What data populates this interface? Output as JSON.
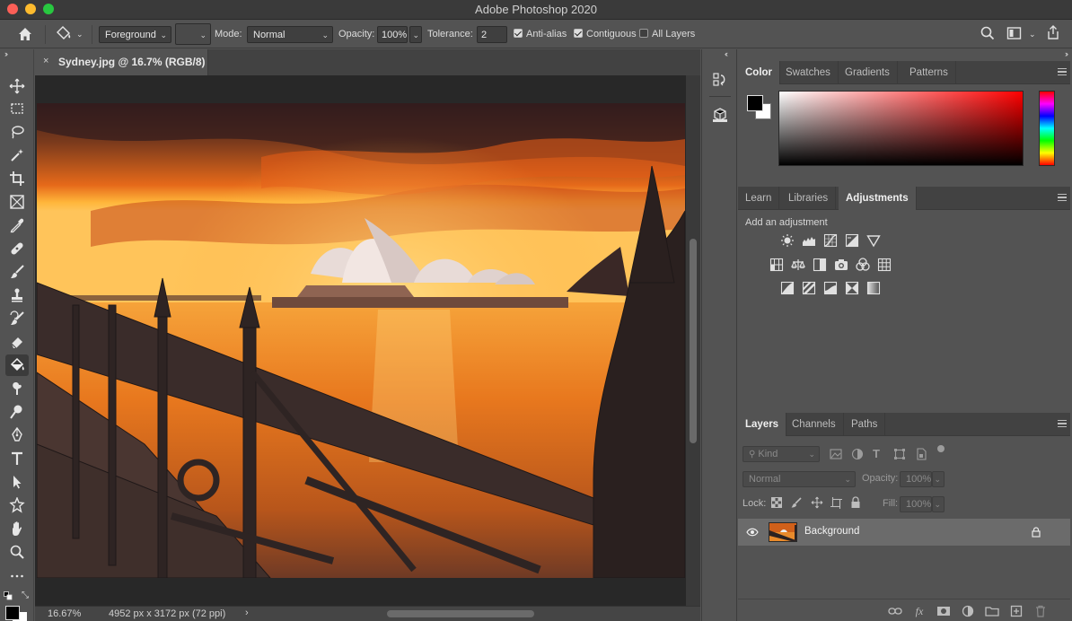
{
  "window": {
    "title": "Adobe Photoshop 2020"
  },
  "options": {
    "fill_source": "Foreground",
    "mode_label": "Mode:",
    "mode_value": "Normal",
    "opacity_label": "Opacity:",
    "opacity_value": "100%",
    "tolerance_label": "Tolerance:",
    "tolerance_value": "2",
    "anti_alias": "Anti-alias",
    "contiguous": "Contiguous",
    "all_layers": "All Layers"
  },
  "document": {
    "tab_title": "Sydney.jpg @ 16.7% (RGB/8)",
    "close": "×"
  },
  "status": {
    "zoom": "16.67%",
    "dimensions": "4952 px x 3172 px (72 ppi)",
    "arrow": "›"
  },
  "color_panel": {
    "tabs": [
      "Color",
      "Swatches",
      "Gradients",
      "Patterns"
    ]
  },
  "adjustments_panel": {
    "tabs": [
      "Learn",
      "Libraries",
      "Adjustments"
    ],
    "add_label": "Add an adjustment"
  },
  "layers_panel": {
    "tabs": [
      "Layers",
      "Channels",
      "Paths"
    ],
    "kind_label": "Kind",
    "blend_mode": "Normal",
    "opacity_label": "Opacity:",
    "opacity_value": "100%",
    "lock_label": "Lock:",
    "fill_label": "Fill:",
    "fill_value": "100%",
    "layers": [
      {
        "name": "Background"
      }
    ]
  },
  "colors": {
    "foreground": "#000000",
    "background": "#ffffff",
    "panel_bg": "#535353"
  }
}
